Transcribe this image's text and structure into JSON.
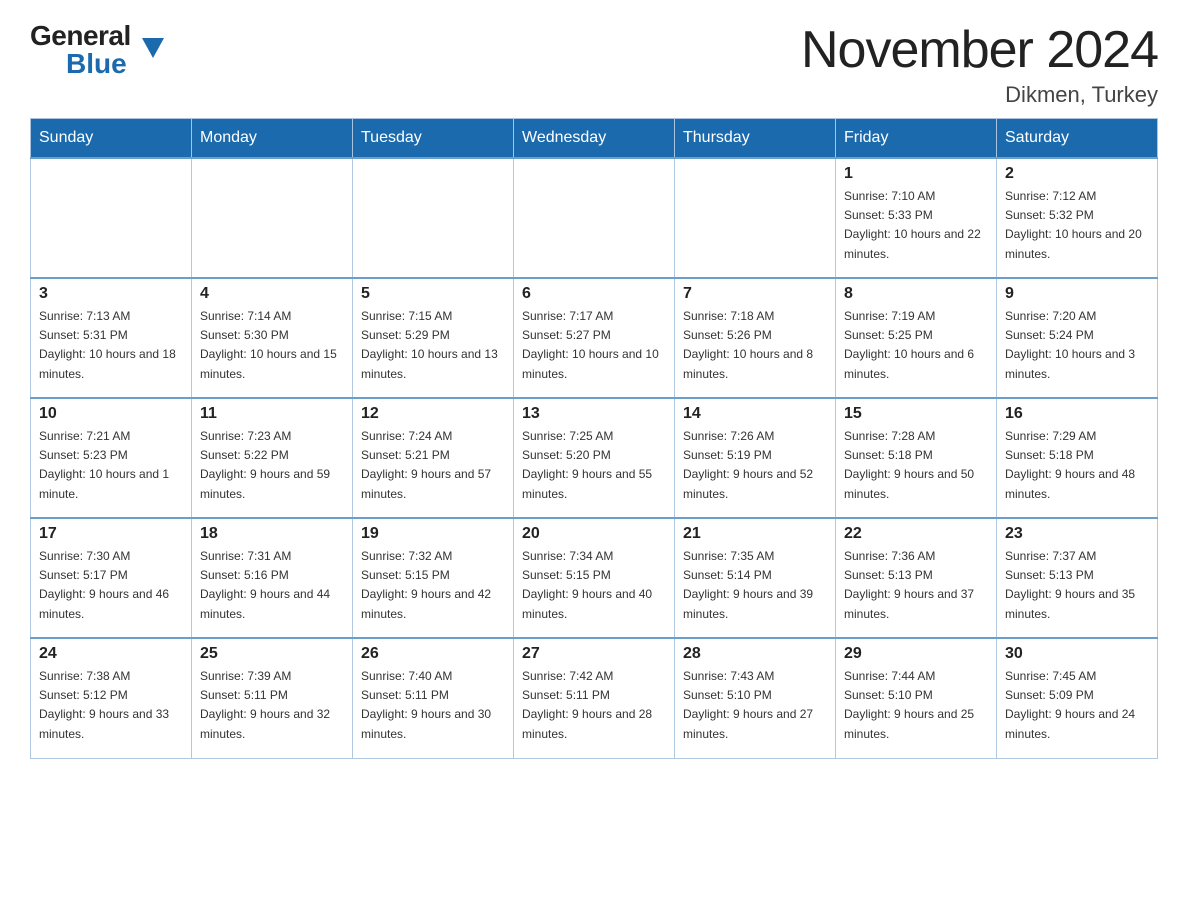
{
  "header": {
    "logo_general": "General",
    "logo_blue": "Blue",
    "month_title": "November 2024",
    "location": "Dikmen, Turkey"
  },
  "days_of_week": [
    "Sunday",
    "Monday",
    "Tuesday",
    "Wednesday",
    "Thursday",
    "Friday",
    "Saturday"
  ],
  "weeks": [
    [
      {
        "num": "",
        "sunrise": "",
        "sunset": "",
        "daylight": ""
      },
      {
        "num": "",
        "sunrise": "",
        "sunset": "",
        "daylight": ""
      },
      {
        "num": "",
        "sunrise": "",
        "sunset": "",
        "daylight": ""
      },
      {
        "num": "",
        "sunrise": "",
        "sunset": "",
        "daylight": ""
      },
      {
        "num": "",
        "sunrise": "",
        "sunset": "",
        "daylight": ""
      },
      {
        "num": "1",
        "sunrise": "Sunrise: 7:10 AM",
        "sunset": "Sunset: 5:33 PM",
        "daylight": "Daylight: 10 hours and 22 minutes."
      },
      {
        "num": "2",
        "sunrise": "Sunrise: 7:12 AM",
        "sunset": "Sunset: 5:32 PM",
        "daylight": "Daylight: 10 hours and 20 minutes."
      }
    ],
    [
      {
        "num": "3",
        "sunrise": "Sunrise: 7:13 AM",
        "sunset": "Sunset: 5:31 PM",
        "daylight": "Daylight: 10 hours and 18 minutes."
      },
      {
        "num": "4",
        "sunrise": "Sunrise: 7:14 AM",
        "sunset": "Sunset: 5:30 PM",
        "daylight": "Daylight: 10 hours and 15 minutes."
      },
      {
        "num": "5",
        "sunrise": "Sunrise: 7:15 AM",
        "sunset": "Sunset: 5:29 PM",
        "daylight": "Daylight: 10 hours and 13 minutes."
      },
      {
        "num": "6",
        "sunrise": "Sunrise: 7:17 AM",
        "sunset": "Sunset: 5:27 PM",
        "daylight": "Daylight: 10 hours and 10 minutes."
      },
      {
        "num": "7",
        "sunrise": "Sunrise: 7:18 AM",
        "sunset": "Sunset: 5:26 PM",
        "daylight": "Daylight: 10 hours and 8 minutes."
      },
      {
        "num": "8",
        "sunrise": "Sunrise: 7:19 AM",
        "sunset": "Sunset: 5:25 PM",
        "daylight": "Daylight: 10 hours and 6 minutes."
      },
      {
        "num": "9",
        "sunrise": "Sunrise: 7:20 AM",
        "sunset": "Sunset: 5:24 PM",
        "daylight": "Daylight: 10 hours and 3 minutes."
      }
    ],
    [
      {
        "num": "10",
        "sunrise": "Sunrise: 7:21 AM",
        "sunset": "Sunset: 5:23 PM",
        "daylight": "Daylight: 10 hours and 1 minute."
      },
      {
        "num": "11",
        "sunrise": "Sunrise: 7:23 AM",
        "sunset": "Sunset: 5:22 PM",
        "daylight": "Daylight: 9 hours and 59 minutes."
      },
      {
        "num": "12",
        "sunrise": "Sunrise: 7:24 AM",
        "sunset": "Sunset: 5:21 PM",
        "daylight": "Daylight: 9 hours and 57 minutes."
      },
      {
        "num": "13",
        "sunrise": "Sunrise: 7:25 AM",
        "sunset": "Sunset: 5:20 PM",
        "daylight": "Daylight: 9 hours and 55 minutes."
      },
      {
        "num": "14",
        "sunrise": "Sunrise: 7:26 AM",
        "sunset": "Sunset: 5:19 PM",
        "daylight": "Daylight: 9 hours and 52 minutes."
      },
      {
        "num": "15",
        "sunrise": "Sunrise: 7:28 AM",
        "sunset": "Sunset: 5:18 PM",
        "daylight": "Daylight: 9 hours and 50 minutes."
      },
      {
        "num": "16",
        "sunrise": "Sunrise: 7:29 AM",
        "sunset": "Sunset: 5:18 PM",
        "daylight": "Daylight: 9 hours and 48 minutes."
      }
    ],
    [
      {
        "num": "17",
        "sunrise": "Sunrise: 7:30 AM",
        "sunset": "Sunset: 5:17 PM",
        "daylight": "Daylight: 9 hours and 46 minutes."
      },
      {
        "num": "18",
        "sunrise": "Sunrise: 7:31 AM",
        "sunset": "Sunset: 5:16 PM",
        "daylight": "Daylight: 9 hours and 44 minutes."
      },
      {
        "num": "19",
        "sunrise": "Sunrise: 7:32 AM",
        "sunset": "Sunset: 5:15 PM",
        "daylight": "Daylight: 9 hours and 42 minutes."
      },
      {
        "num": "20",
        "sunrise": "Sunrise: 7:34 AM",
        "sunset": "Sunset: 5:15 PM",
        "daylight": "Daylight: 9 hours and 40 minutes."
      },
      {
        "num": "21",
        "sunrise": "Sunrise: 7:35 AM",
        "sunset": "Sunset: 5:14 PM",
        "daylight": "Daylight: 9 hours and 39 minutes."
      },
      {
        "num": "22",
        "sunrise": "Sunrise: 7:36 AM",
        "sunset": "Sunset: 5:13 PM",
        "daylight": "Daylight: 9 hours and 37 minutes."
      },
      {
        "num": "23",
        "sunrise": "Sunrise: 7:37 AM",
        "sunset": "Sunset: 5:13 PM",
        "daylight": "Daylight: 9 hours and 35 minutes."
      }
    ],
    [
      {
        "num": "24",
        "sunrise": "Sunrise: 7:38 AM",
        "sunset": "Sunset: 5:12 PM",
        "daylight": "Daylight: 9 hours and 33 minutes."
      },
      {
        "num": "25",
        "sunrise": "Sunrise: 7:39 AM",
        "sunset": "Sunset: 5:11 PM",
        "daylight": "Daylight: 9 hours and 32 minutes."
      },
      {
        "num": "26",
        "sunrise": "Sunrise: 7:40 AM",
        "sunset": "Sunset: 5:11 PM",
        "daylight": "Daylight: 9 hours and 30 minutes."
      },
      {
        "num": "27",
        "sunrise": "Sunrise: 7:42 AM",
        "sunset": "Sunset: 5:11 PM",
        "daylight": "Daylight: 9 hours and 28 minutes."
      },
      {
        "num": "28",
        "sunrise": "Sunrise: 7:43 AM",
        "sunset": "Sunset: 5:10 PM",
        "daylight": "Daylight: 9 hours and 27 minutes."
      },
      {
        "num": "29",
        "sunrise": "Sunrise: 7:44 AM",
        "sunset": "Sunset: 5:10 PM",
        "daylight": "Daylight: 9 hours and 25 minutes."
      },
      {
        "num": "30",
        "sunrise": "Sunrise: 7:45 AM",
        "sunset": "Sunset: 5:09 PM",
        "daylight": "Daylight: 9 hours and 24 minutes."
      }
    ]
  ]
}
